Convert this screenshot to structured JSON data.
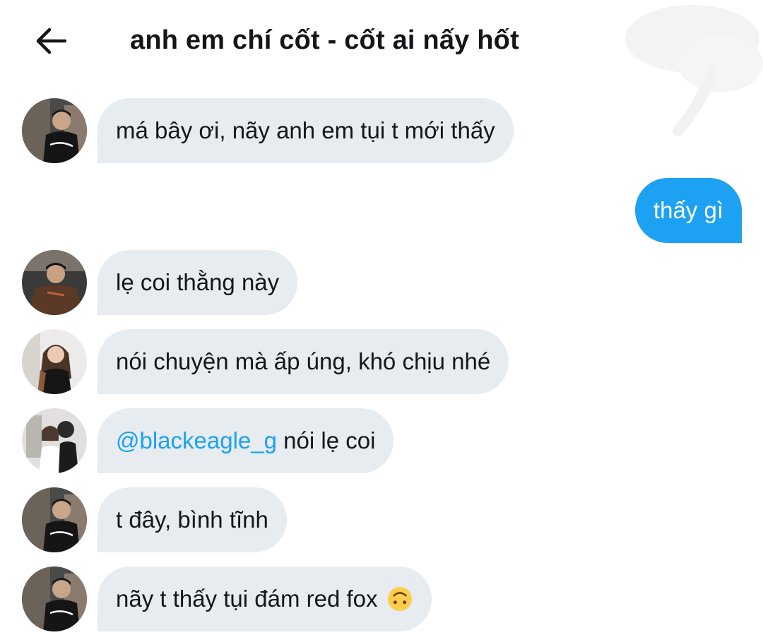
{
  "header": {
    "title": "anh em chí cốt - cốt ai nấy hốt",
    "back_icon": "arrow-left-icon"
  },
  "colors": {
    "incoming_bubble": "#e6ecf0",
    "outgoing_bubble": "#1da1f2",
    "mention": "#1da1f2",
    "text": "#14171a"
  },
  "messages": [
    {
      "direction": "incoming",
      "text": "má bây ơi, nãy anh em tụi t mới thấy"
    },
    {
      "direction": "outgoing",
      "text": "thấy gì"
    },
    {
      "direction": "incoming",
      "text": "lẹ coi thằng này"
    },
    {
      "direction": "incoming",
      "text": "nói chuyện mà ấp úng, khó chịu nhé"
    },
    {
      "direction": "incoming",
      "mention": "@blackeagle_g",
      "text": " nói lẹ coi"
    },
    {
      "direction": "incoming",
      "text": "t đây, bình tĩnh"
    },
    {
      "direction": "incoming",
      "text": "nãy t thấy tụi đám red fox",
      "emoji": "upside-down-face-emoji"
    }
  ]
}
